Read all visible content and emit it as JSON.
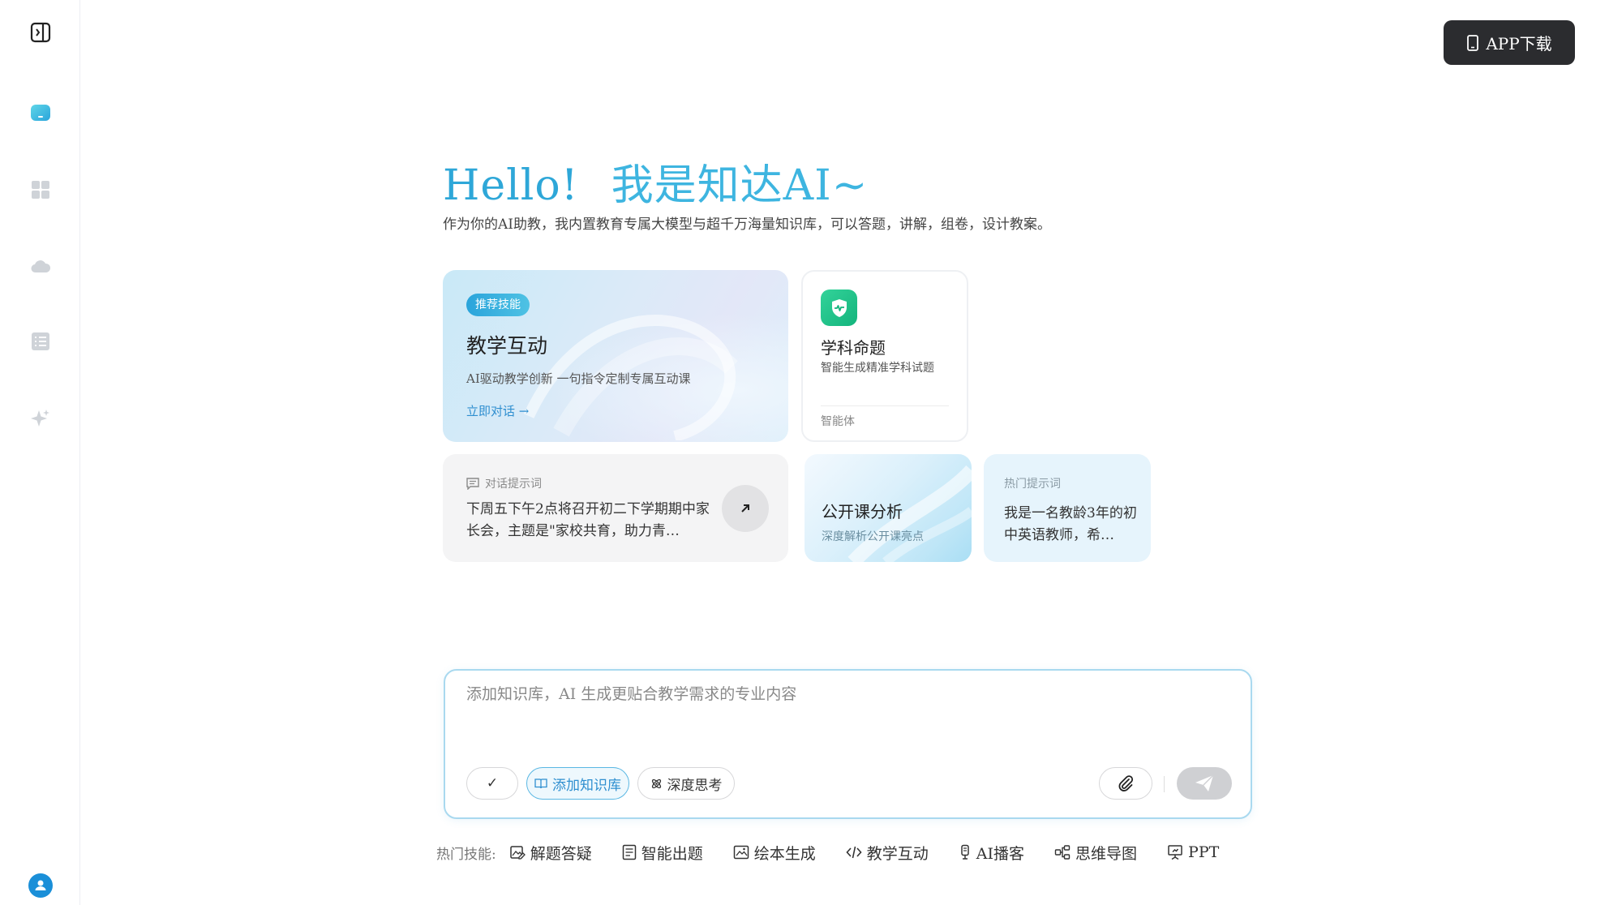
{
  "top_button": {
    "label": "APP下载"
  },
  "hero": {
    "title_hello": "Hello!",
    "title_name": "我是知达AI~",
    "subtitle": "作为你的AI助教，我内置教育专属大模型与超千万海量知识库，可以答题，讲解，组卷，设计教案。"
  },
  "cards": {
    "teach": {
      "badge": "推荐技能",
      "title": "教学互动",
      "desc": "AI驱动教学创新 一句指令定制专属互动课",
      "link": "立即对话 →"
    },
    "subject": {
      "title": "学科命题",
      "desc": "智能生成精准学科试题",
      "tag": "智能体"
    },
    "prompt": {
      "label": "对话提示词",
      "text": "下周五下午2点将召开初二下学期期中家长会，主题是\"家校共育，助力青…"
    },
    "open_class": {
      "title": "公开课分析",
      "desc": "深度解析公开课亮点"
    },
    "hot": {
      "label": "热门提示词",
      "text": "我是一名教龄3年的初中英语教师，希…"
    }
  },
  "input": {
    "placeholder": "添加知识库，AI 生成更贴合教学需求的专业内容",
    "check_label": "✓",
    "kb_label": "添加知识库",
    "deep_label": "深度思考"
  },
  "skills": {
    "label": "热门技能:",
    "items": [
      "解题答疑",
      "智能出题",
      "绘本生成",
      "教学互动",
      "AI播客",
      "思维导图",
      "PPT"
    ]
  },
  "colors": {
    "accent": "#2ea7d8",
    "dark_button": "#2b2c2f",
    "subject_green": "#14b47c"
  }
}
